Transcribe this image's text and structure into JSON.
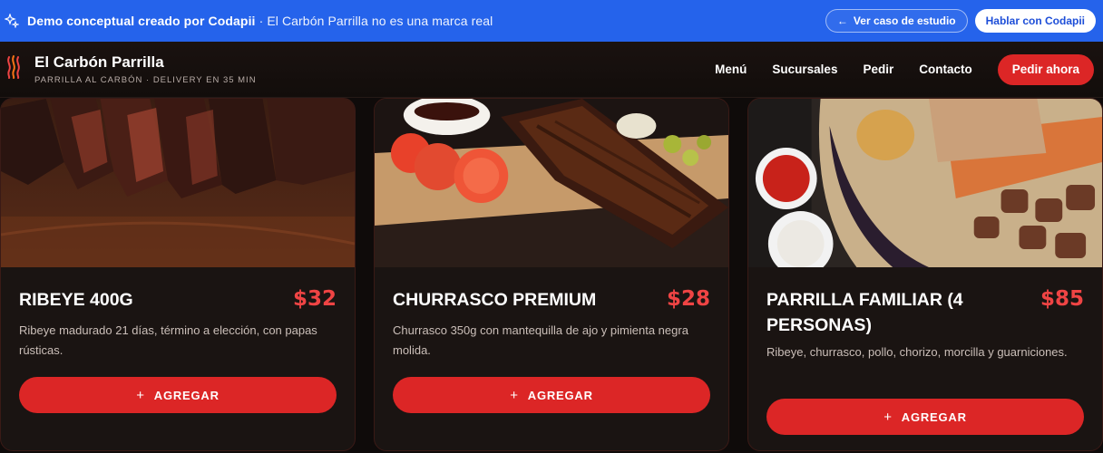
{
  "banner": {
    "title": "Demo conceptual creado por Codapii",
    "subtitle": "· El Carbón Parrilla no es una marca real",
    "case_study": "Ver caso de estudio",
    "contact": "Hablar con Codapii"
  },
  "nav": {
    "brand": "El Carbón Parrilla",
    "tagline": "PARRILLA AL CARBÓN · DELIVERY EN 35 MIN",
    "links": [
      "Menú",
      "Sucursales",
      "Pedir",
      "Contacto"
    ],
    "cta": "Pedir ahora"
  },
  "cards": [
    {
      "title": "RIBEYE 400G",
      "price": "$32",
      "description": "Ribeye madurado 21 días, término a elección, con papas rústicas.",
      "button": "AGREGAR"
    },
    {
      "title": "CHURRASCO PREMIUM",
      "price": "$28",
      "description": "Churrasco 350g con mantequilla de ajo y pimienta negra molida.",
      "button": "AGREGAR"
    },
    {
      "title": "PARRILLA FAMILIAR (4 PERSONAS)",
      "price": "$85",
      "description": "Ribeye, churrasco, pollo, chorizo, morcilla y guarniciones.",
      "button": "AGREGAR"
    }
  ],
  "colors": {
    "banner": "#2563eb",
    "accent": "#dc2626",
    "price": "#ef4444",
    "card_bg": "#1a1412"
  }
}
